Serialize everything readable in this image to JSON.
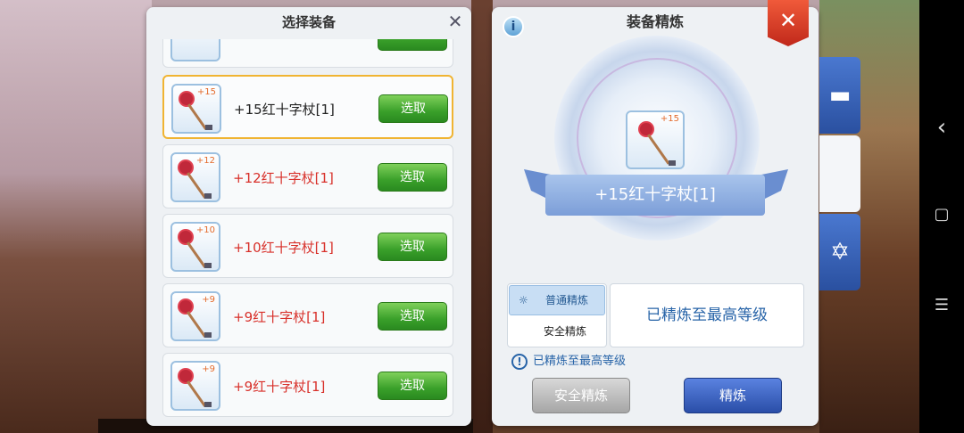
{
  "left_panel": {
    "title": "选择装备",
    "close_icon": "close-icon",
    "items": [
      {
        "level": "+15",
        "name": "+15红十字杖[1]",
        "button": "选取",
        "name_color": "#222222",
        "selected": true
      },
      {
        "level": "+12",
        "name": "+12红十字杖[1]",
        "button": "选取",
        "name_color": "#d8302a",
        "selected": false
      },
      {
        "level": "+10",
        "name": "+10红十字杖[1]",
        "button": "选取",
        "name_color": "#d8302a",
        "selected": false
      },
      {
        "level": "+9",
        "name": "+9红十字杖[1]",
        "button": "选取",
        "name_color": "#d8302a",
        "selected": false
      },
      {
        "level": "+9",
        "name": "+9红十字杖[1]",
        "button": "选取",
        "name_color": "#d8302a",
        "selected": false
      }
    ]
  },
  "right_panel": {
    "title": "装备精炼",
    "info_icon": "i",
    "close_label": "✕",
    "center_item": {
      "level": "+15",
      "name": "+15红十字杖[1]"
    },
    "modes": {
      "normal": "普通精炼",
      "safe": "安全精炼"
    },
    "status_text": "已精炼至最高等级",
    "notice": "已精炼至最高等级",
    "buttons": {
      "safe_refine": "安全精炼",
      "refine": "精炼"
    }
  },
  "side_tabs": [
    "anvil-icon",
    "blank-tab",
    "hexagram-icon"
  ],
  "navbar": {
    "back": "‹",
    "home": "▢",
    "menu": "☰"
  },
  "colors": {
    "accent_blue": "#2864a8",
    "select_green": "#3aa02a",
    "close_red": "#d0301e"
  }
}
